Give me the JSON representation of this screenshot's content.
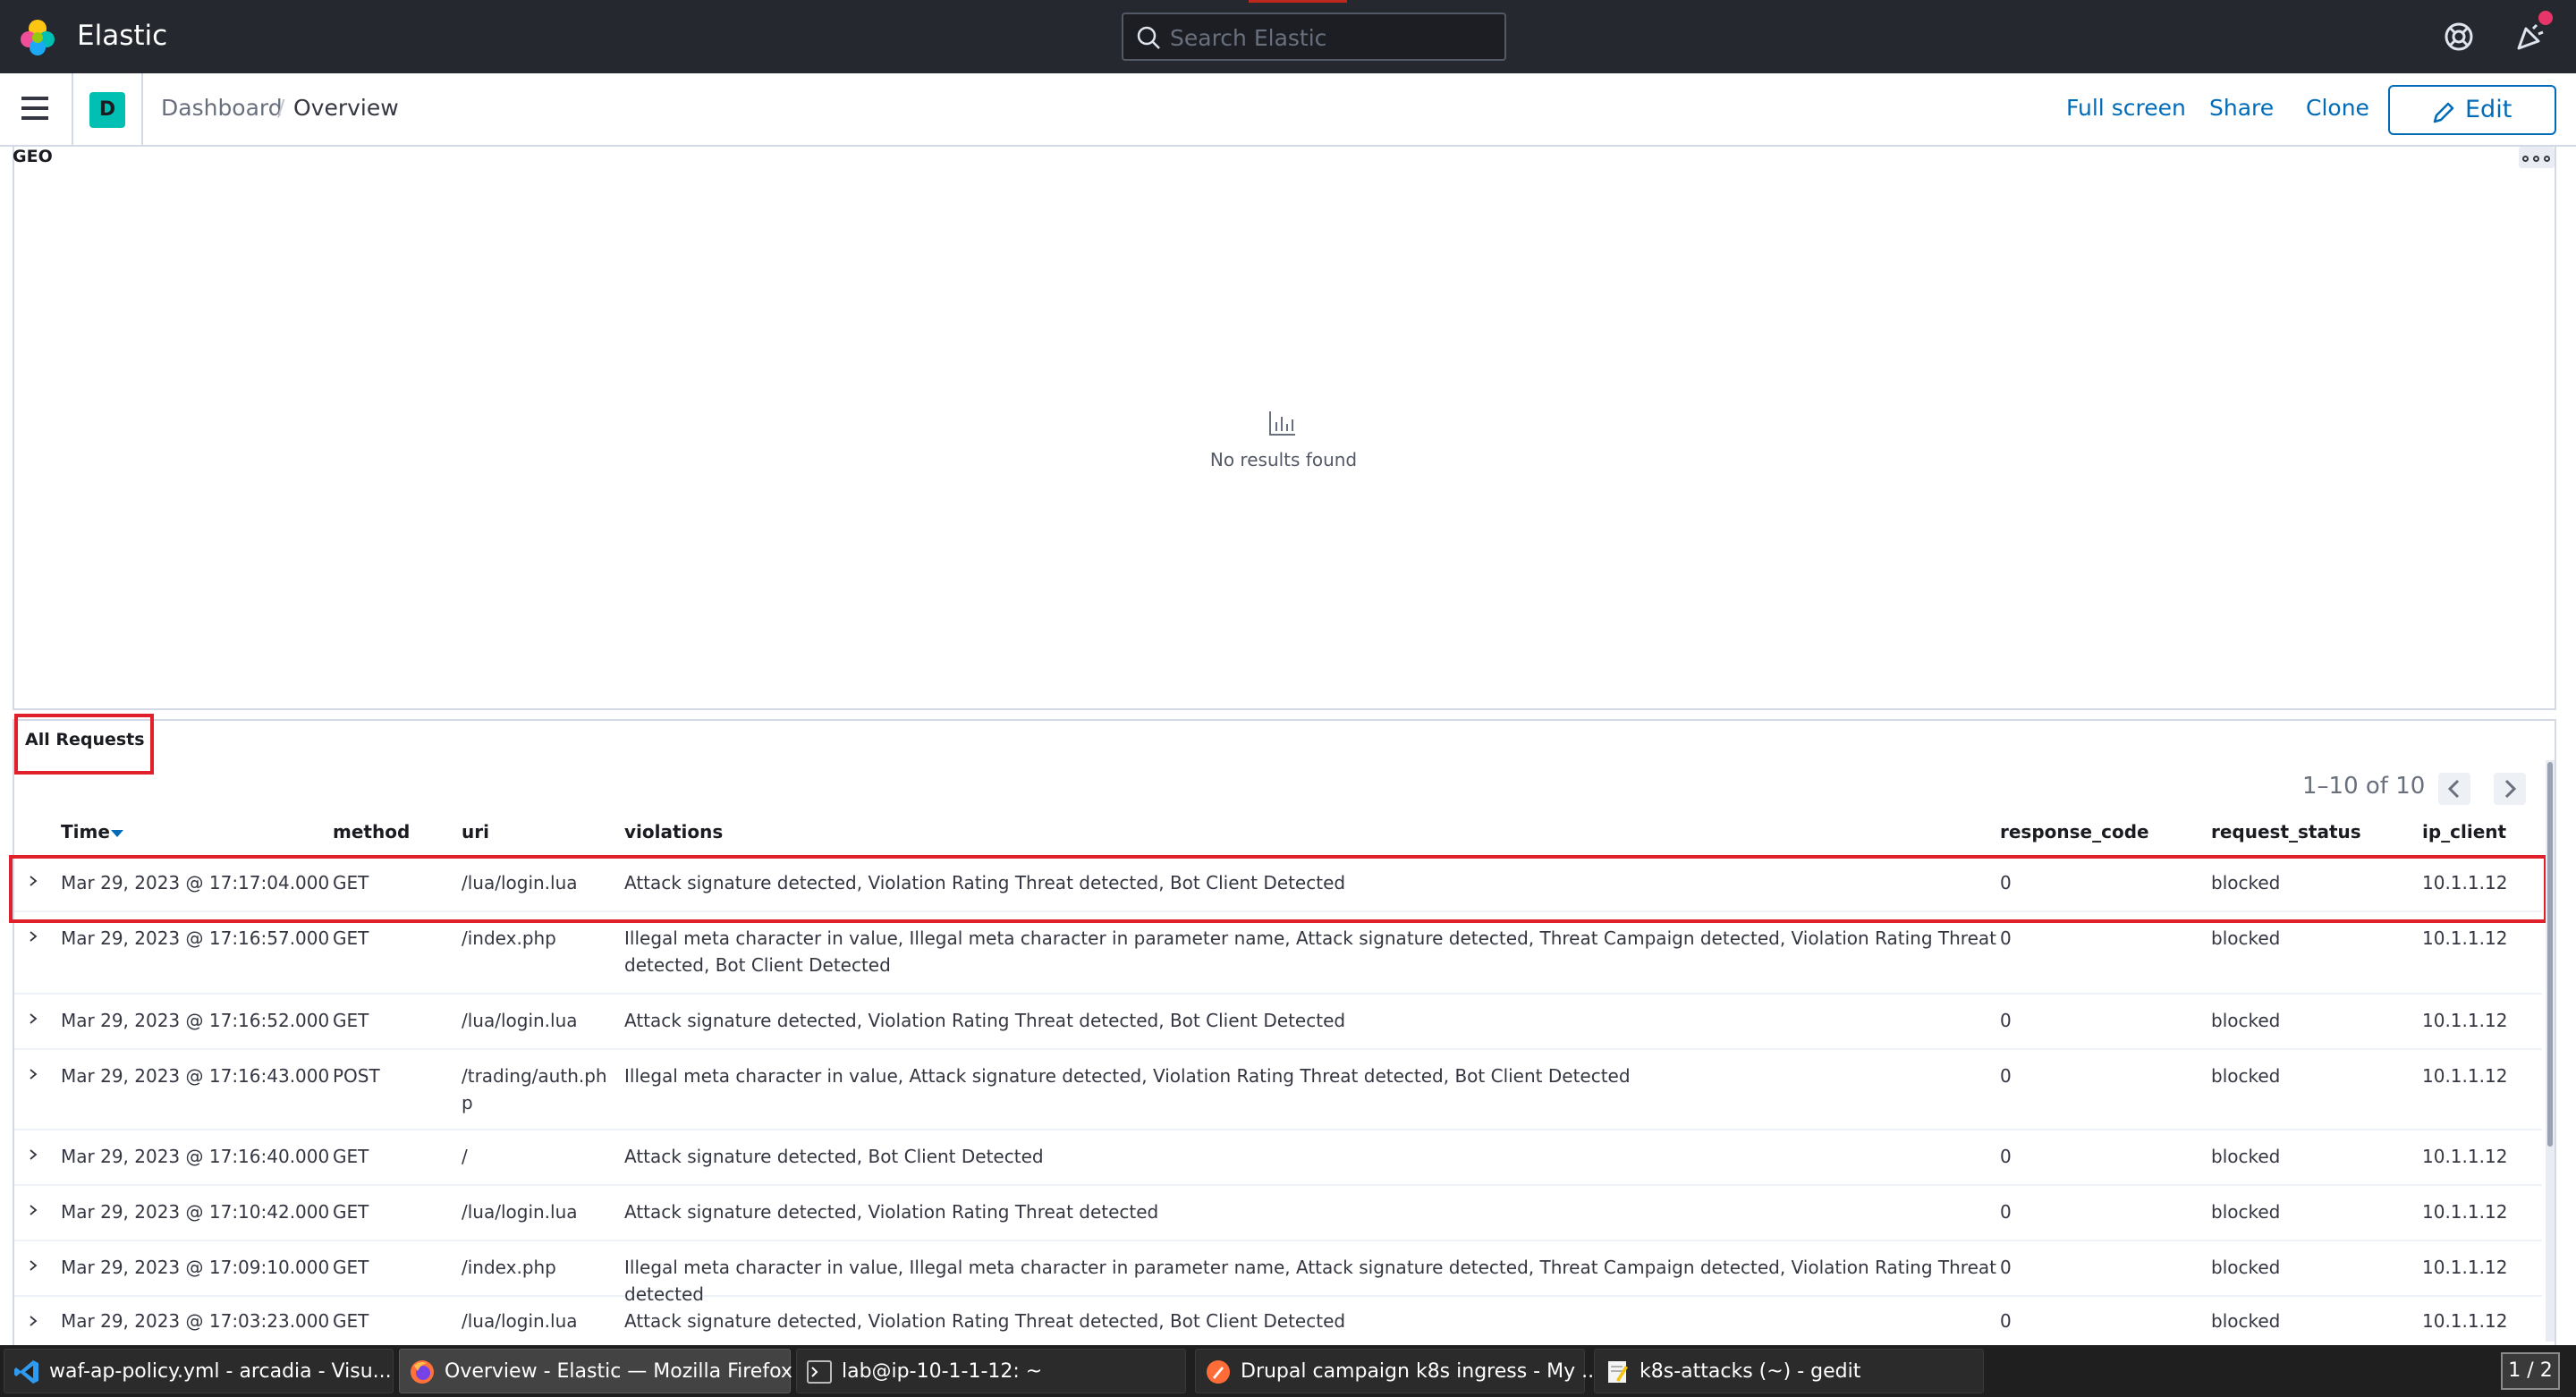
{
  "header": {
    "brand": "Elastic",
    "search_placeholder": "Search Elastic"
  },
  "subheader": {
    "space_initial": "D",
    "breadcrumbs": [
      "Dashboard",
      "Overview"
    ],
    "separator": "/",
    "actions": {
      "full_screen": "Full screen",
      "share": "Share",
      "clone": "Clone",
      "edit": "Edit"
    }
  },
  "geo_panel": {
    "title": "GEO",
    "empty_message": "No results found"
  },
  "requests_panel": {
    "title": "All Requests",
    "pagination": "1–10 of 10",
    "columns": {
      "time": "Time",
      "method": "method",
      "uri": "uri",
      "violations": "violations",
      "response_code": "response_code",
      "request_status": "request_status",
      "ip_client": "ip_client"
    },
    "rows": [
      {
        "time": "Mar 29, 2023 @ 17:17:04.000",
        "method": "GET",
        "uri": "/lua/login.lua",
        "violations": "Attack signature detected, Violation Rating Threat detected, Bot Client Detected",
        "response_code": "0",
        "request_status": "blocked",
        "ip_client": "10.1.1.12"
      },
      {
        "time": "Mar 29, 2023 @ 17:16:57.000",
        "method": "GET",
        "uri": "/index.php",
        "violations": "Illegal meta character in value, Illegal meta character in parameter name, Attack signature detected, Threat Campaign detected, Violation Rating Threat detected, Bot Client Detected",
        "response_code": "0",
        "request_status": "blocked",
        "ip_client": "10.1.1.12"
      },
      {
        "time": "Mar 29, 2023 @ 17:16:52.000",
        "method": "GET",
        "uri": "/lua/login.lua",
        "violations": "Attack signature detected, Violation Rating Threat detected, Bot Client Detected",
        "response_code": "0",
        "request_status": "blocked",
        "ip_client": "10.1.1.12"
      },
      {
        "time": "Mar 29, 2023 @ 17:16:43.000",
        "method": "POST",
        "uri": "/trading/auth.php",
        "violations": "Illegal meta character in value, Attack signature detected, Violation Rating Threat detected, Bot Client Detected",
        "response_code": "0",
        "request_status": "blocked",
        "ip_client": "10.1.1.12"
      },
      {
        "time": "Mar 29, 2023 @ 17:16:40.000",
        "method": "GET",
        "uri": "/",
        "violations": "Attack signature detected, Bot Client Detected",
        "response_code": "0",
        "request_status": "blocked",
        "ip_client": "10.1.1.12"
      },
      {
        "time": "Mar 29, 2023 @ 17:10:42.000",
        "method": "GET",
        "uri": "/lua/login.lua",
        "violations": "Attack signature detected, Violation Rating Threat detected",
        "response_code": "0",
        "request_status": "blocked",
        "ip_client": "10.1.1.12"
      },
      {
        "time": "Mar 29, 2023 @ 17:09:10.000",
        "method": "GET",
        "uri": "/index.php",
        "violations": "Illegal meta character in value, Illegal meta character in parameter name, Attack signature detected, Threat Campaign detected, Violation Rating Threat detected",
        "response_code": "0",
        "request_status": "blocked",
        "ip_client": "10.1.1.12"
      },
      {
        "time": "Mar 29, 2023 @ 17:03:23.000",
        "method": "GET",
        "uri": "/lua/login.lua",
        "violations": "Attack signature detected, Violation Rating Threat detected, Bot Client Detected",
        "response_code": "0",
        "request_status": "blocked",
        "ip_client": "10.1.1.12"
      }
    ]
  },
  "taskbar": {
    "tasks": [
      {
        "label": "waf-ap-policy.yml - arcadia - Visu...",
        "icon": "vscode-icon"
      },
      {
        "label": "Overview - Elastic — Mozilla Firefox",
        "icon": "firefox-icon"
      },
      {
        "label": "lab@ip-10-1-1-12: ~",
        "icon": "terminal-icon"
      },
      {
        "label": "Drupal campaign k8s ingress - My ...",
        "icon": "postman-icon"
      },
      {
        "label": "k8s-attacks (~) - gedit",
        "icon": "gedit-icon"
      }
    ],
    "workspace": "1 / 2"
  },
  "colors": {
    "header_bg": "#25282f",
    "link": "#006bb8",
    "highlight": "#e0202a",
    "space_avatar": "#00bfb3"
  }
}
